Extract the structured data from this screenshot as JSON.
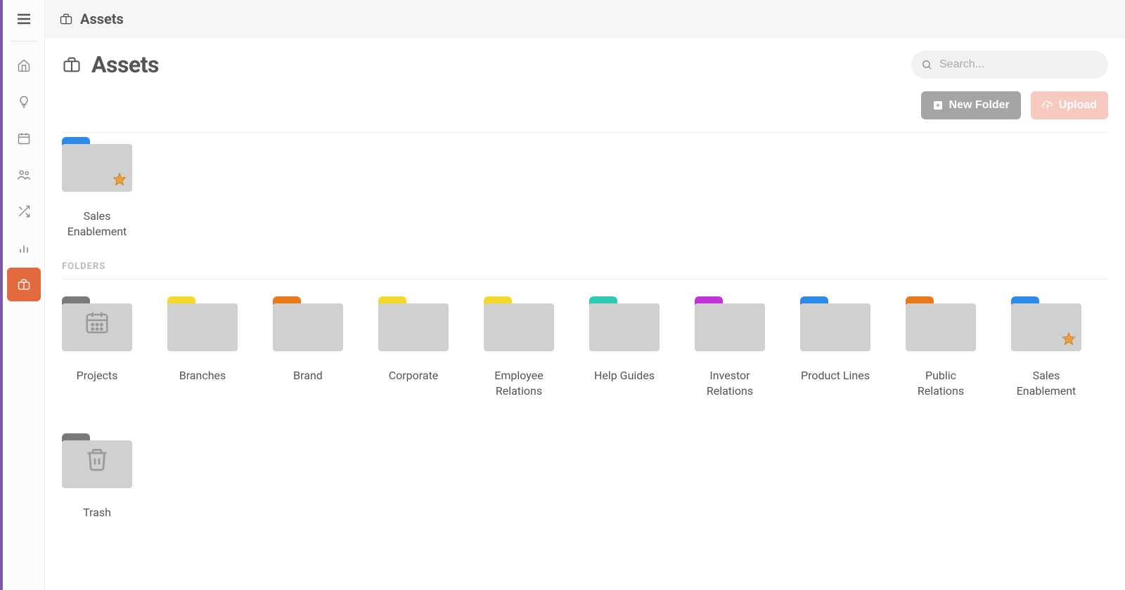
{
  "app": {
    "title": "Assets"
  },
  "page": {
    "title": "Assets"
  },
  "search": {
    "placeholder": "Search..."
  },
  "buttons": {
    "new_folder": "New Folder",
    "upload": "Upload"
  },
  "sections": {
    "folders_label": "FOLDERS"
  },
  "sidebar": {
    "items": [
      {
        "name": "home-icon"
      },
      {
        "name": "bulb-icon"
      },
      {
        "name": "calendar-icon"
      },
      {
        "name": "people-icon"
      },
      {
        "name": "shuffle-icon"
      },
      {
        "name": "chart-icon"
      },
      {
        "name": "briefcase-icon",
        "active": true
      }
    ]
  },
  "pinned": [
    {
      "label": "Sales Enablement",
      "tab_color": "#2d8be8",
      "star": true
    }
  ],
  "folders": [
    {
      "label": "Projects",
      "tab_color": "#7a7a7a",
      "overlay": "calendar"
    },
    {
      "label": "Branches",
      "tab_color": "#f4d92a"
    },
    {
      "label": "Brand",
      "tab_color": "#e87a1e"
    },
    {
      "label": "Corporate",
      "tab_color": "#f4d92a"
    },
    {
      "label": "Employee Relations",
      "tab_color": "#f4d92a"
    },
    {
      "label": "Help Guides",
      "tab_color": "#2dc9b0"
    },
    {
      "label": "Investor Relations",
      "tab_color": "#c233d9"
    },
    {
      "label": "Product Lines",
      "tab_color": "#2d8be8"
    },
    {
      "label": "Public Relations",
      "tab_color": "#e87a1e"
    },
    {
      "label": "Sales Enablement",
      "tab_color": "#2d8be8",
      "star": true
    },
    {
      "label": "Trash",
      "tab_color": "#7a7a7a",
      "overlay": "trash"
    }
  ]
}
